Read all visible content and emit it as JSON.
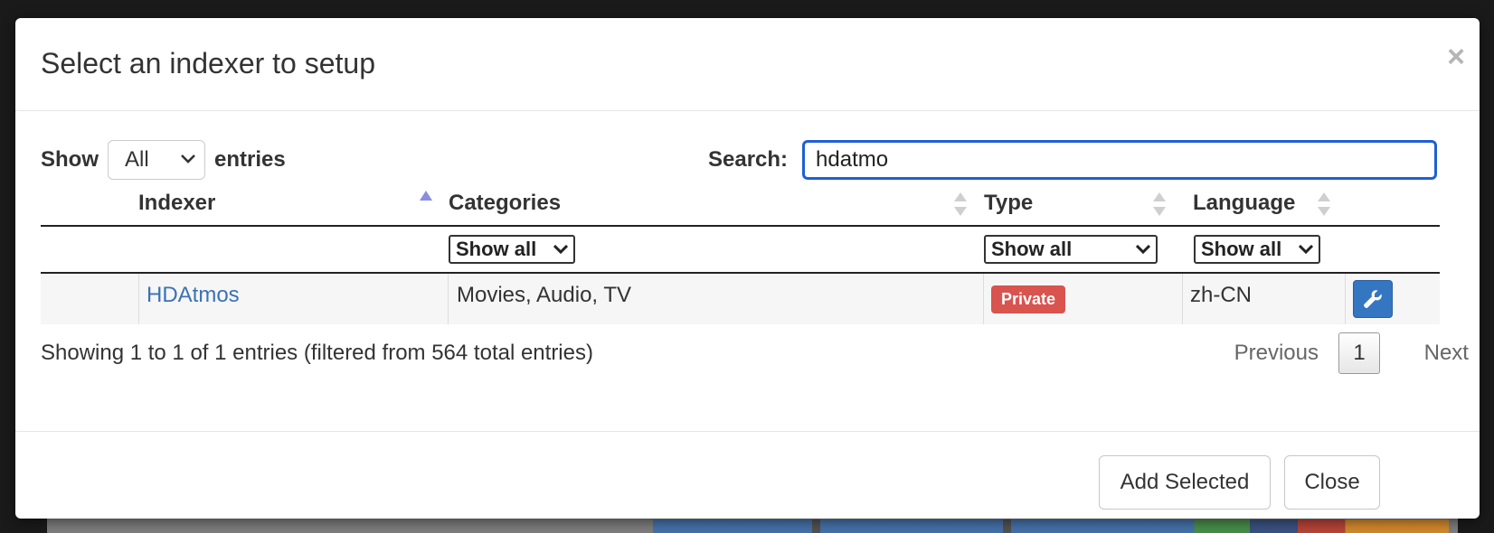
{
  "modal": {
    "title": "Select an indexer to setup",
    "close_symbol": "×"
  },
  "length": {
    "prefix": "Show",
    "selected": "All",
    "suffix": "entries"
  },
  "search": {
    "label": "Search:",
    "value": "hdatmo"
  },
  "table": {
    "columns": [
      "Indexer",
      "Categories",
      "Type",
      "Language"
    ],
    "filters": {
      "categories": "Show all",
      "type": "Show all",
      "language": "Show all"
    },
    "rows": [
      {
        "indexer": "HDAtmos",
        "categories": "Movies, Audio, TV",
        "type": "Private",
        "language": "zh-CN",
        "action_icon": "wrench-icon"
      }
    ]
  },
  "info": "Showing 1 to 1 of 1 entries (filtered from 564 total entries)",
  "pagination": {
    "previous": "Previous",
    "current": "1",
    "next": "Next"
  },
  "footer": {
    "add_selected": "Add Selected",
    "close": "Close"
  },
  "colors": {
    "accent": "#1f5fd6",
    "link": "#3a72b5",
    "badge_private": "#d9534f",
    "action_button": "#3576c3"
  }
}
